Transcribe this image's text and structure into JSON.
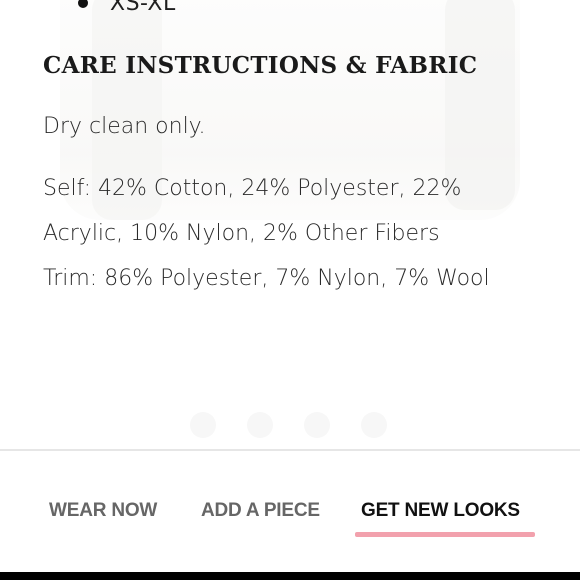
{
  "sizes": {
    "label": "XS-XL"
  },
  "care": {
    "title": "CARE INSTRUCTIONS & FABRIC",
    "cleaning": "Dry clean only.",
    "self": "Self: 42% Cotton, 24% Polyester, 22% Acrylic, 10% Nylon, 2% Other Fibers",
    "trim": "Trim: 86% Polyester, 7% Nylon, 7% Wool"
  },
  "carousel": {
    "dot_count": 4
  },
  "tabs": [
    {
      "label": "WEAR NOW",
      "active": false
    },
    {
      "label": "ADD A PIECE",
      "active": false
    },
    {
      "label": "GET NEW LOOKS",
      "active": true
    }
  ],
  "colors": {
    "active_underline": "#f2a1ad",
    "inactive_tab": "#666666",
    "active_tab": "#111111"
  }
}
